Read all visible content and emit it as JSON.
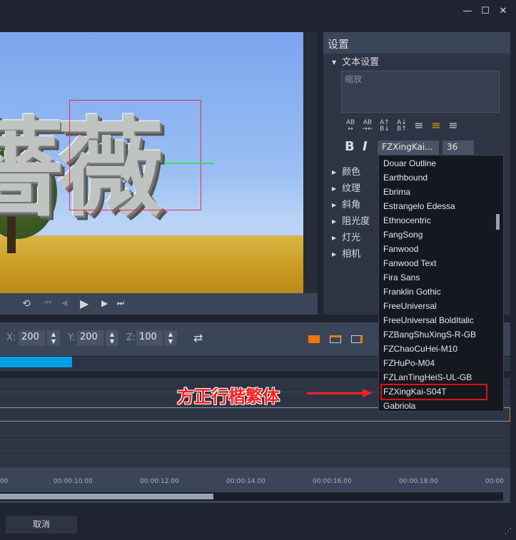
{
  "window": {
    "minimize": "—",
    "maximize": "☐",
    "close": "✕"
  },
  "preview": {
    "text": "薔薇"
  },
  "playback": {
    "loop": "⟲",
    "first": "⏮",
    "prev": "◀",
    "play": "▶",
    "next": "▶",
    "last": "⏭"
  },
  "settings": {
    "title": "设置",
    "text_section": "文本设置",
    "text_value": "缩放",
    "bold": "B",
    "italic": "I",
    "font": "FZXingKai...",
    "size": "36",
    "sections": [
      "颜色",
      "纹理",
      "斜角",
      "阻光度",
      "灯光",
      "相机"
    ]
  },
  "font_list": [
    "Douar Outline",
    "Earthbound",
    "Ebrima",
    "Estrangelo Edessa",
    "Ethnocentric",
    "FangSong",
    "Fanwood",
    "Fanwood Text",
    "Fira Sans",
    "Franklin Gothic",
    "FreeUniversal",
    "FreeUniversal BoldItalic",
    "FZBangShuXingS-R-GB",
    "FZChaoCuHei-M10",
    "FZHuPo-M04",
    "FZLanTingHeiS-UL-GB",
    "FZXingKai-S04T",
    "Gabriola"
  ],
  "annotation": "方正行楷繁体",
  "position": {
    "x_label": "X:",
    "x": "200",
    "y_label": "Y:",
    "y": "200",
    "z_label": "Z:",
    "z": "100"
  },
  "ruler": [
    "00",
    "00:00:10.00",
    "00:00:12.00",
    "00:00:14.00",
    "00:00:16.00",
    "00:00:18.00",
    "00:00"
  ],
  "footer": {
    "cancel": "取消"
  },
  "colors": {
    "accent": "#f07800",
    "clip": "#00a0e8",
    "highlight": "#e01010"
  }
}
